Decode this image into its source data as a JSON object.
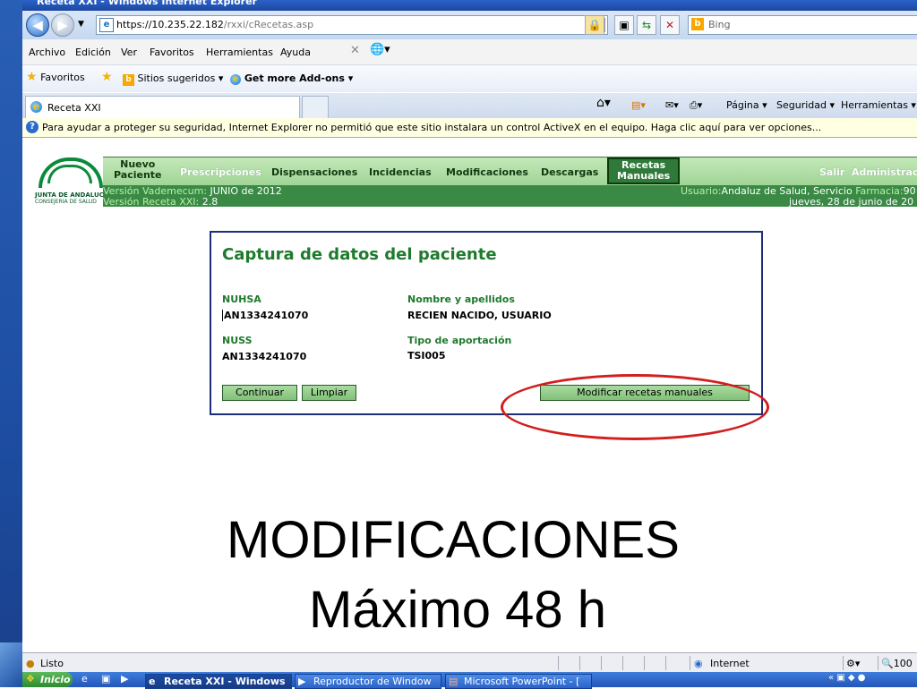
{
  "window": {
    "title": "Receta XXI - Windows Internet Explorer"
  },
  "address": {
    "url_host": "https://10.235.22.182",
    "url_path": "/rxxi/cRecetas.asp"
  },
  "search": {
    "placeholder": "Bing"
  },
  "menu": [
    "Archivo",
    "Edición",
    "Ver",
    "Favoritos",
    "Herramientas",
    "Ayuda"
  ],
  "favorites": {
    "label": "Favoritos",
    "suggested": "Sitios sugeridos",
    "addons": "Get more Add-ons"
  },
  "tab": {
    "label": "Receta XXI"
  },
  "commands": {
    "page": "Página",
    "security": "Seguridad",
    "tools": "Herramientas"
  },
  "infobar": {
    "text": "Para ayudar a proteger su seguridad, Internet Explorer no permitió que este sitio instalara un control ActiveX en el equipo. Haga clic aquí para ver opciones..."
  },
  "logo": {
    "line1": "JUNTA DE ANDALUCIA",
    "line2": "CONSEJERIA DE SALUD"
  },
  "nav": {
    "nuevo_paciente_1": "Nuevo",
    "nuevo_paciente_2": "Paciente",
    "prescripciones": "Prescripciones",
    "dispensaciones": "Dispensaciones",
    "incidencias": "Incidencias",
    "modificaciones": "Modificaciones",
    "descargas": "Descargas",
    "recetas_1": "Recetas",
    "recetas_2": "Manuales",
    "salir": "Salir",
    "administracion": "Administraci"
  },
  "info": {
    "vademecum_label": "Versión Vademecum:",
    "vademecum_value": "JUNIO de 2012",
    "receta_label": "Versión Receta XXI:",
    "receta_value": "2.8",
    "usuario_label": "Usuario:",
    "usuario_value": "Andaluz de Salud, Servicio",
    "farmacia_label": "Farmacia:",
    "farmacia_value": "90",
    "fecha": "jueves, 28 de junio de 20"
  },
  "form": {
    "title": "Captura de datos del paciente",
    "nuhsa_label": "NUHSA",
    "nuhsa_value": "AN1334241070",
    "nombre_label": "Nombre y apellidos",
    "nombre_value": "RECIEN NACIDO, USUARIO",
    "nuss_label": "NUSS",
    "nuss_value": "AN1334241070",
    "aportacion_label": "Tipo de aportación",
    "aportacion_value": "TSI005",
    "continuar": "Continuar",
    "limpiar": "Limpiar",
    "modificar": "Modificar recetas manuales"
  },
  "overlay": {
    "line1": "MODIFICACIONES",
    "line2": "Máximo 48 h"
  },
  "status": {
    "text": "Listo",
    "zone": "Internet",
    "zoom": "100"
  },
  "taskbar": {
    "start": "Inicio",
    "task1": "Receta XXI - Windows",
    "task2": "Reproductor de Window",
    "task3": "Microsoft PowerPoint - ["
  },
  "colors": {
    "nav_green": "#9fd495",
    "form_green": "#1e7a2c",
    "highlight_red": "#d21e1e",
    "panel_border": "#1c2f78"
  }
}
